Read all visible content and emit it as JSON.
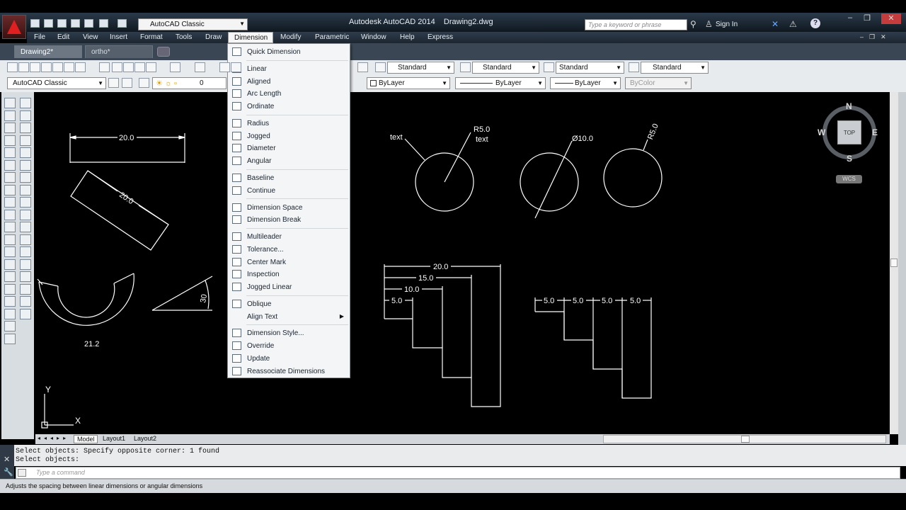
{
  "window": {
    "title": "Autodesk AutoCAD 2014    Drawing2.dwg",
    "workspace": "AutoCAD Classic",
    "search_placeholder": "Type a keyword or phrase",
    "sign_in": "Sign In"
  },
  "menubar": {
    "items": [
      "File",
      "Edit",
      "View",
      "Insert",
      "Format",
      "Tools",
      "Draw",
      "Dimension",
      "Modify",
      "Parametric",
      "Window",
      "Help",
      "Express"
    ],
    "active": "Dimension"
  },
  "doc_tabs": [
    "Drawing2*",
    "ortho*"
  ],
  "toolbar": {
    "text_style": "Standard",
    "dim_style": "Standard",
    "table_style": "Standard",
    "mleader_style": "Standard",
    "workspace": "AutoCAD Classic",
    "layer": "0",
    "color": "ByLayer",
    "linetype": "ByLayer",
    "lineweight": "ByLayer",
    "plotstyle": "ByColor"
  },
  "dimension_menu": {
    "groups": [
      [
        "Quick Dimension"
      ],
      [
        "Linear",
        "Aligned",
        "Arc Length",
        "Ordinate"
      ],
      [
        "Radius",
        "Jogged",
        "Diameter",
        "Angular"
      ],
      [
        "Baseline",
        "Continue"
      ],
      [
        "Dimension Space",
        "Dimension Break"
      ],
      [
        "Multileader",
        "Tolerance...",
        "Center Mark",
        "Inspection",
        "Jogged Linear"
      ],
      [
        "Oblique",
        "Align Text"
      ],
      [
        "Dimension Style...",
        "Override",
        "Update",
        "Reassociate Dimensions"
      ]
    ],
    "submenu_item": "Align Text"
  },
  "drawing": {
    "dims": {
      "linear_top": "20.0",
      "aligned": "20.0",
      "arc": "21.2",
      "angle": "30",
      "radius_label": "R5.0",
      "radius_text": "text",
      "leader_text": "text",
      "diameter": "Ø10.0",
      "radius_rotated": "R5.0",
      "baseline_20": "20.0",
      "baseline_15": "15.0",
      "baseline_10": "10.0",
      "baseline_5": "5.0",
      "cont_1": "5.0",
      "cont_2": "5.0",
      "cont_3": "5.0",
      "cont_4": "5.0"
    },
    "ucs": {
      "x": "X",
      "y": "Y"
    }
  },
  "viewcube": {
    "n": "N",
    "s": "S",
    "e": "E",
    "w": "W",
    "face": "TOP",
    "wcs": "WCS"
  },
  "layout_tabs": [
    "Model",
    "Layout1",
    "Layout2"
  ],
  "command": {
    "history": [
      "Select objects: Specify opposite corner: 1 found",
      "Select objects:"
    ],
    "placeholder": "Type a command"
  },
  "status": "Adjusts the spacing between linear dimensions or angular dimensions",
  "colors": {
    "accent": "#e02020",
    "canvas": "#000000",
    "geometry": "#ffffff"
  }
}
